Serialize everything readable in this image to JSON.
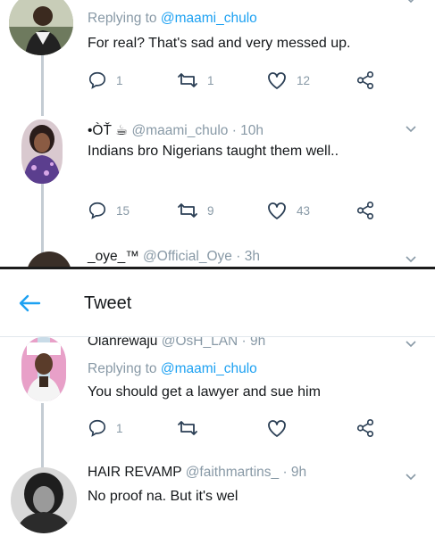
{
  "top_thread": {
    "tweet1": {
      "replying_prefix": "Replying to ",
      "replying_mention": "@maami_chulo",
      "text": "For real? That's sad and very messed up.",
      "replies": "1",
      "retweets": "1",
      "likes": "12"
    },
    "tweet2": {
      "name": "•ÒŤ ☕",
      "handle": "@maami_chulo",
      "time": " · 10h",
      "text": "Indians bro Nigerians taught them well..",
      "replies": "15",
      "retweets": "9",
      "likes": "43"
    },
    "tweet3": {
      "name": "_oye_™",
      "handle": "@Official_Oye",
      "time": " · 3h"
    }
  },
  "header": {
    "title": "Tweet"
  },
  "bottom_thread": {
    "tweet1": {
      "name": "Olanrewaju",
      "handle": "@OsH_LAN",
      "time": " · 9h",
      "replying_prefix": "Replying to ",
      "replying_mention": "@maami_chulo",
      "text": "You should get a lawyer and sue him",
      "replies": "1"
    },
    "tweet2": {
      "name": "HAIR REVAMP",
      "handle": "@faithmartins_",
      "time": " · 9h",
      "text": "No proof na. But it's wel"
    }
  },
  "colors": {
    "accent": "#1da1f2",
    "muted": "#8899a6",
    "text": "#14171a",
    "thread_line": "#c4ccd3"
  }
}
